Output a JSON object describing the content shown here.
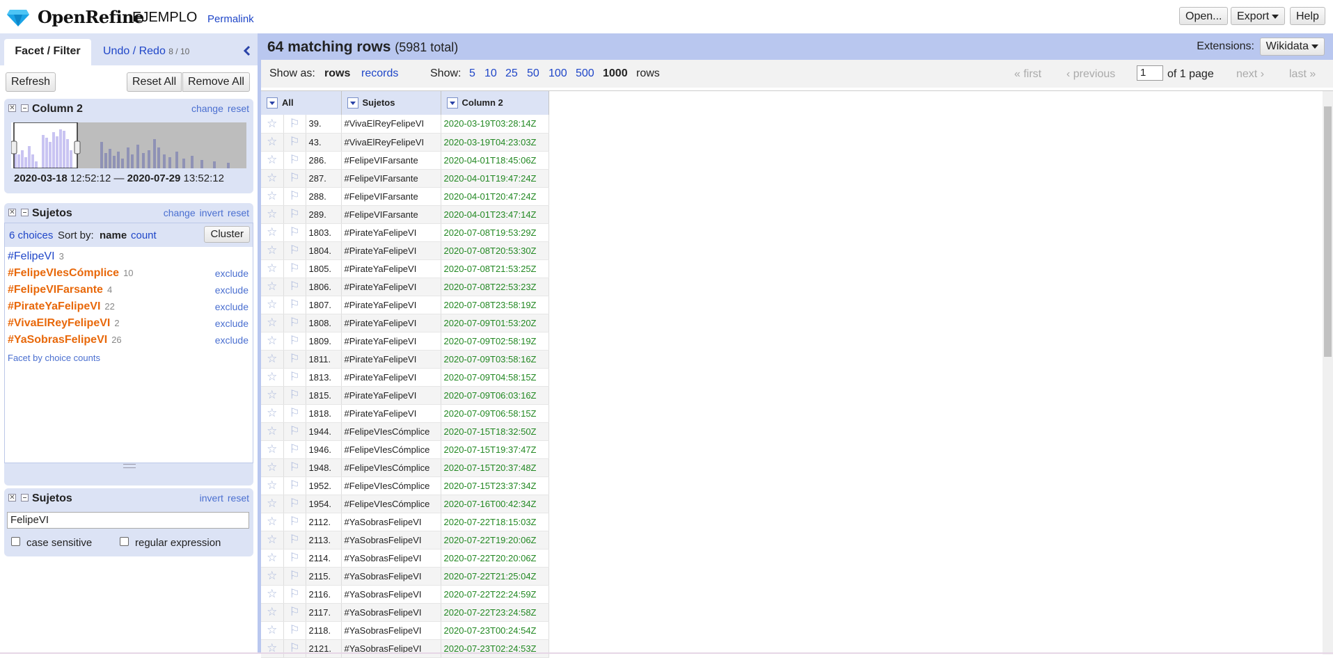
{
  "header": {
    "app_name": "OpenRefine",
    "project_name": "EJEMPLO",
    "permalink": "Permalink",
    "open_label": "Open...",
    "export_label": "Export",
    "help_label": "Help"
  },
  "left_panel": {
    "tab_facet": "Facet / Filter",
    "tab_undo": "Undo / Redo",
    "undo_count": "8 / 10",
    "refresh": "Refresh",
    "reset_all": "Reset All",
    "remove_all": "Remove All",
    "timeline_facet": {
      "title": "Column 2",
      "change": "change",
      "reset": "reset",
      "from_date": "2020-03-18",
      "from_time": "12:52:12",
      "dash": "—",
      "to_date": "2020-07-29",
      "to_time": "13:52:12"
    },
    "list_facet": {
      "title": "Sujetos",
      "change": "change",
      "invert": "invert",
      "reset": "reset",
      "choices_count": "6 choices",
      "sort_by": "Sort by:",
      "sort_name": "name",
      "sort_count": "count",
      "cluster": "Cluster",
      "exclude": "exclude",
      "facet_by_counts": "Facet by choice counts",
      "choices": [
        {
          "name": "#FelipeVI",
          "count": "3",
          "selected": false
        },
        {
          "name": "#FelipeVIesCómplice",
          "count": "10",
          "selected": true
        },
        {
          "name": "#FelipeVIFarsante",
          "count": "4",
          "selected": true
        },
        {
          "name": "#PirateYaFelipeVI",
          "count": "22",
          "selected": true
        },
        {
          "name": "#VivaElReyFelipeVI",
          "count": "2",
          "selected": true
        },
        {
          "name": "#YaSobrasFelipeVI",
          "count": "26",
          "selected": true
        }
      ]
    },
    "text_facet": {
      "title": "Sujetos",
      "invert": "invert",
      "reset": "reset",
      "value": "FelipeVI",
      "case_sensitive": "case sensitive",
      "regex": "regular expression"
    }
  },
  "grid": {
    "matching": "64 matching rows",
    "total": "(5981 total)",
    "extensions_label": "Extensions:",
    "extensions_button": "Wikidata",
    "show_as": "Show as:",
    "rows_mode": "rows",
    "records_mode": "records",
    "show": "Show:",
    "page_sizes": [
      "5",
      "10",
      "25",
      "50",
      "100",
      "500",
      "1000"
    ],
    "rows_word": "rows",
    "first": "« first",
    "previous": "‹ previous",
    "page_value": "1",
    "of_pages": "of 1 page",
    "next": "next ›",
    "last": "last »",
    "columns": [
      "All",
      "Sujetos",
      "Column 2"
    ],
    "rows": [
      [
        "39.",
        "#VivaElReyFelipeVI",
        "2020-03-19T03:28:14Z"
      ],
      [
        "43.",
        "#VivaElReyFelipeVI",
        "2020-03-19T04:23:03Z"
      ],
      [
        "286.",
        "#FelipeVIFarsante",
        "2020-04-01T18:45:06Z"
      ],
      [
        "287.",
        "#FelipeVIFarsante",
        "2020-04-01T19:47:24Z"
      ],
      [
        "288.",
        "#FelipeVIFarsante",
        "2020-04-01T20:47:24Z"
      ],
      [
        "289.",
        "#FelipeVIFarsante",
        "2020-04-01T23:47:14Z"
      ],
      [
        "1803.",
        "#PirateYaFelipeVI",
        "2020-07-08T19:53:29Z"
      ],
      [
        "1804.",
        "#PirateYaFelipeVI",
        "2020-07-08T20:53:30Z"
      ],
      [
        "1805.",
        "#PirateYaFelipeVI",
        "2020-07-08T21:53:25Z"
      ],
      [
        "1806.",
        "#PirateYaFelipeVI",
        "2020-07-08T22:53:23Z"
      ],
      [
        "1807.",
        "#PirateYaFelipeVI",
        "2020-07-08T23:58:19Z"
      ],
      [
        "1808.",
        "#PirateYaFelipeVI",
        "2020-07-09T01:53:20Z"
      ],
      [
        "1809.",
        "#PirateYaFelipeVI",
        "2020-07-09T02:58:19Z"
      ],
      [
        "1811.",
        "#PirateYaFelipeVI",
        "2020-07-09T03:58:16Z"
      ],
      [
        "1813.",
        "#PirateYaFelipeVI",
        "2020-07-09T04:58:15Z"
      ],
      [
        "1815.",
        "#PirateYaFelipeVI",
        "2020-07-09T06:03:16Z"
      ],
      [
        "1818.",
        "#PirateYaFelipeVI",
        "2020-07-09T06:58:15Z"
      ],
      [
        "1944.",
        "#FelipeVIesCómplice",
        "2020-07-15T18:32:50Z"
      ],
      [
        "1946.",
        "#FelipeVIesCómplice",
        "2020-07-15T19:37:47Z"
      ],
      [
        "1948.",
        "#FelipeVIesCómplice",
        "2020-07-15T20:37:48Z"
      ],
      [
        "1952.",
        "#FelipeVIesCómplice",
        "2020-07-15T23:37:34Z"
      ],
      [
        "1954.",
        "#FelipeVIesCómplice",
        "2020-07-16T00:42:34Z"
      ],
      [
        "2112.",
        "#YaSobrasFelipeVI",
        "2020-07-22T18:15:03Z"
      ],
      [
        "2113.",
        "#YaSobrasFelipeVI",
        "2020-07-22T19:20:06Z"
      ],
      [
        "2114.",
        "#YaSobrasFelipeVI",
        "2020-07-22T20:20:06Z"
      ],
      [
        "2115.",
        "#YaSobrasFelipeVI",
        "2020-07-22T21:25:04Z"
      ],
      [
        "2116.",
        "#YaSobrasFelipeVI",
        "2020-07-22T22:24:59Z"
      ],
      [
        "2117.",
        "#YaSobrasFelipeVI",
        "2020-07-22T23:24:58Z"
      ],
      [
        "2118.",
        "#YaSobrasFelipeVI",
        "2020-07-23T00:24:54Z"
      ],
      [
        "2121.",
        "#YaSobrasFelipeVI",
        "2020-07-23T02:24:53Z"
      ]
    ]
  },
  "colors": {
    "selected_choice": "#e8680a",
    "date_text": "#228822",
    "facet_bg": "#dce3f5",
    "link": "#1f46c8"
  }
}
